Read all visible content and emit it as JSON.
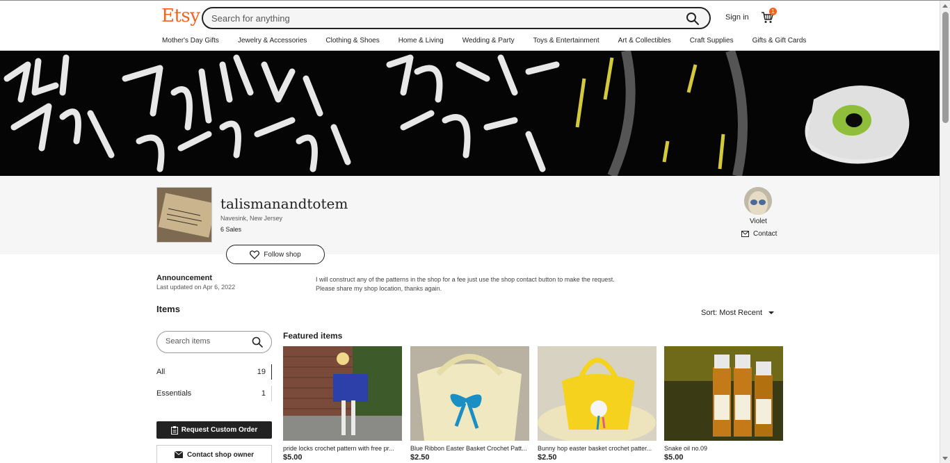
{
  "header": {
    "logo": "Etsy",
    "search_placeholder": "Search for anything",
    "signin_label": "Sign in",
    "cart_count": "1",
    "nav": [
      "Mother's Day Gifts",
      "Jewelry & Accessories",
      "Clothing & Shoes",
      "Home & Living",
      "Wedding & Party",
      "Toys & Entertainment",
      "Art & Collectibles",
      "Craft Supplies",
      "Gifts & Gift Cards"
    ]
  },
  "shop": {
    "name": "talismanandtotem",
    "location": "Navesink, New Jersey",
    "sales": "6 Sales",
    "follow_label": "Follow shop",
    "owner_name": "Violet",
    "contact_label": "Contact"
  },
  "announcement": {
    "title": "Announcement",
    "updated": "Last updated on Apr 6, 2022",
    "text_line1": "I will construct any of the patterns in the shop for a fee just use the shop contact button to make the request.",
    "text_line2": "Please share my shop location, thanks again."
  },
  "items": {
    "title": "Items",
    "sort_label": "Sort: Most Recent",
    "search_placeholder": "Search items",
    "categories": [
      {
        "label": "All",
        "count": "19"
      },
      {
        "label": "Essentials",
        "count": "1"
      }
    ],
    "request_label": "Request Custom Order",
    "contact_owner_label": "Contact shop owner",
    "featured_title": "Featured items",
    "products": [
      {
        "title": "pride locks crochet pattern with free pr...",
        "price": "$5.00"
      },
      {
        "title": "Blue Ribbon Easter Basket Crochet Patt...",
        "price": "$2.50"
      },
      {
        "title": "Bunny hop easter basket crochet patter...",
        "price": "$2.50"
      },
      {
        "title": "Snake oil no.09",
        "price": "$5.00"
      }
    ]
  },
  "colors": {
    "brand": "#f1641e",
    "dark": "#222222"
  }
}
